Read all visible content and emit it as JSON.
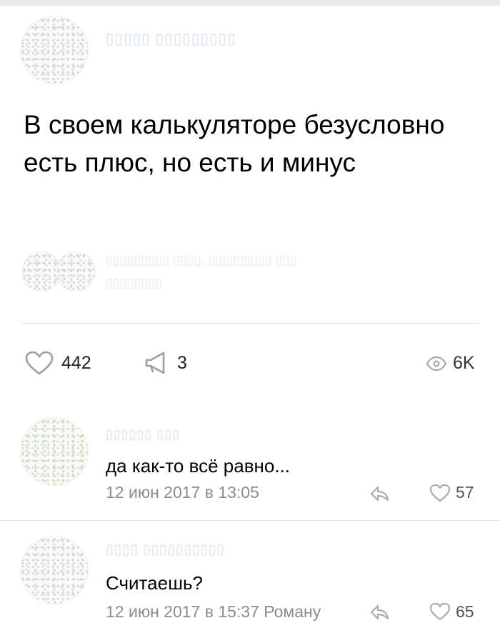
{
  "post": {
    "text": "В своем калькуляторе безусловно есть плюс, но есть и минус",
    "stats": {
      "likes": "442",
      "reposts": "3",
      "views": "6K"
    }
  },
  "comments": [
    {
      "text": "да как-то всё равно...",
      "meta": "12 июн 2017 в 13:05",
      "likes": "57"
    },
    {
      "text": "Считаешь?",
      "meta": "12 июн 2017 в 15:37 Роману",
      "likes": "65"
    }
  ]
}
